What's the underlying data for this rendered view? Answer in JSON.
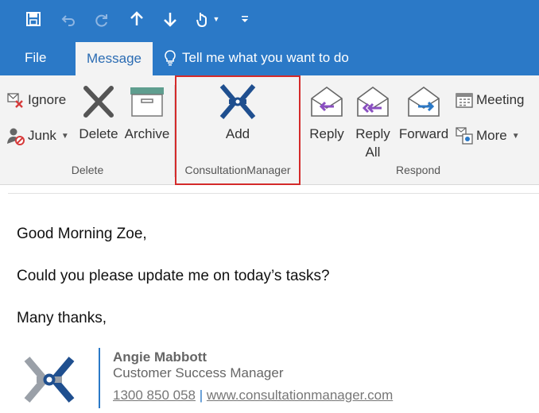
{
  "tabs": {
    "file": "File",
    "message": "Message",
    "tell_me": "Tell me what you want to do"
  },
  "ribbon": {
    "delete_group": {
      "label": "Delete",
      "ignore": "Ignore",
      "junk": "Junk",
      "delete": "Delete",
      "archive": "Archive"
    },
    "cm_group": {
      "label": "ConsultationManager",
      "add": "Add"
    },
    "respond_group": {
      "label": "Respond",
      "reply": "Reply",
      "reply_all_line1": "Reply",
      "reply_all_line2": "All",
      "forward": "Forward",
      "meeting": "Meeting",
      "more": "More"
    }
  },
  "message": {
    "greeting": "Good Morning Zoe,",
    "body": "Could you please update me on today’s tasks?",
    "closing": "Many thanks,"
  },
  "signature": {
    "name": "Angie Mabbott",
    "title": "Customer Success Manager",
    "phone": "1300 850 058",
    "separator": "|",
    "website": "www.consultationmanager.com"
  },
  "colors": {
    "accent": "#2b79c7",
    "logo_blue": "#1f4f8f",
    "highlight_border": "#d42a2a",
    "reply_arrow": "#8a4fc1",
    "forward_arrow": "#2b79c7"
  },
  "icons": {
    "save": "save-icon",
    "undo": "undo-icon",
    "redo": "redo-icon",
    "up": "arrow-up-icon",
    "down": "arrow-down-icon",
    "touch": "touch-mode-icon",
    "customize": "customize-qat-icon",
    "lightbulb": "lightbulb-icon"
  }
}
